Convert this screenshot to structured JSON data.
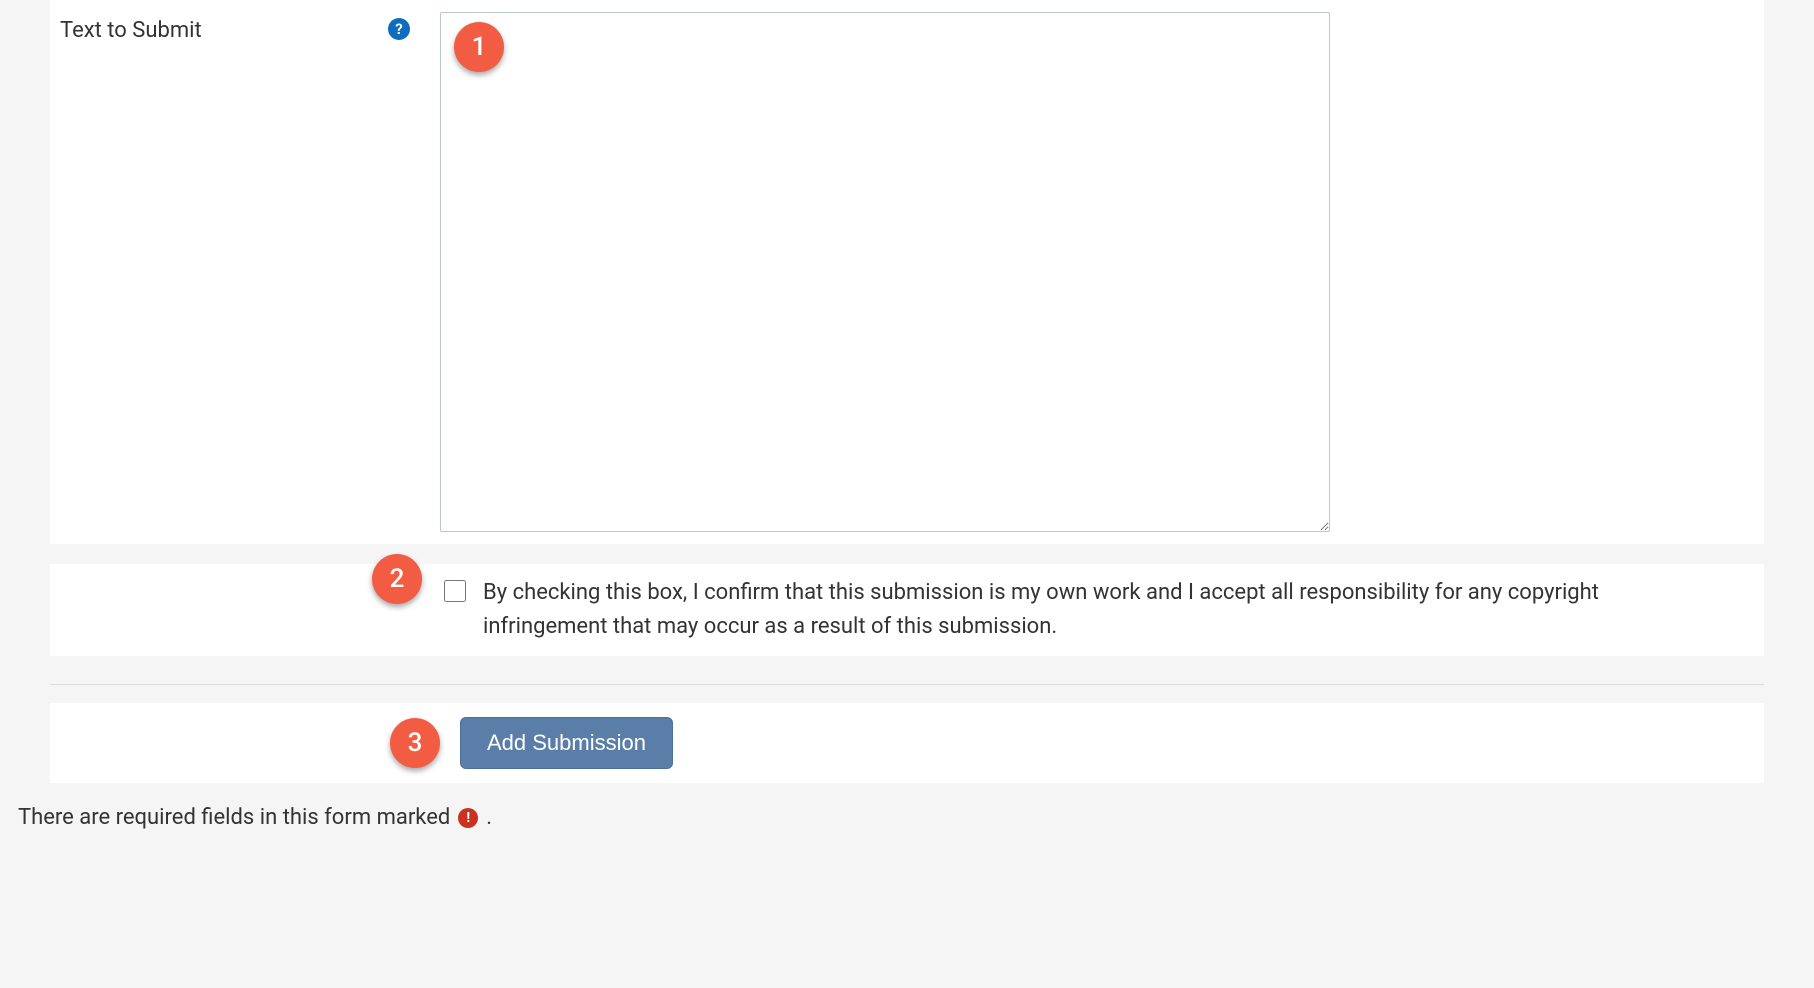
{
  "form": {
    "text_submit_label": "Text to Submit",
    "help_icon_glyph": "?",
    "textarea_value": "",
    "confirm_checkbox_label": "By checking this box, I confirm that this submission is my own work and I accept all responsibility for any copyright infringement that may occur as a result of this submission.",
    "submit_button_label": "Add Submission",
    "required_note_prefix": "There are required fields in this form marked",
    "required_icon_glyph": "!",
    "required_note_suffix": "."
  },
  "callouts": {
    "badge1": "1",
    "badge2": "2",
    "badge3": "3"
  }
}
